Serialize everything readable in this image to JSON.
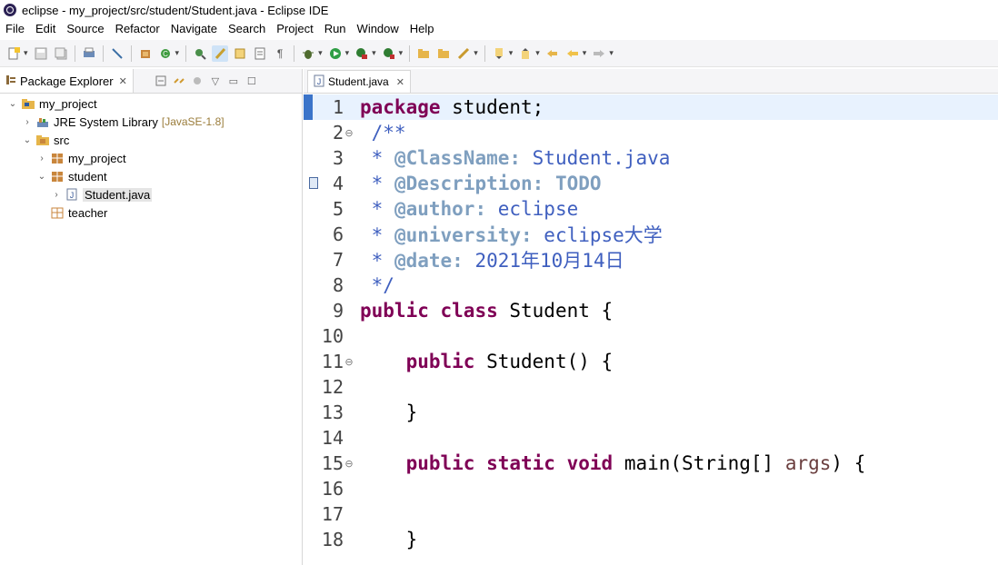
{
  "window": {
    "title": "eclipse - my_project/src/student/Student.java - Eclipse IDE",
    "app_icon": "eclipse-icon"
  },
  "menu": [
    "File",
    "Edit",
    "Source",
    "Refactor",
    "Navigate",
    "Search",
    "Project",
    "Run",
    "Window",
    "Help"
  ],
  "toolbar": {
    "icons": [
      "new-icon",
      "save-icon",
      "save-all-icon",
      "print-icon",
      "debug-skip-icon",
      "new-java-package-icon",
      "refresh-icon",
      "open-type-icon",
      "toggle-mark-icon",
      "open-task-icon",
      "open-task-list-icon",
      "pilcrow-icon",
      "debug-icon",
      "run-icon",
      "coverage-icon",
      "external-tools-icon",
      "open-folder-icon",
      "open-folder-2-icon",
      "search-icon",
      "next-annotation-icon",
      "prev-annotation-icon",
      "back-icon",
      "forward-icon"
    ]
  },
  "package_explorer": {
    "tab_label": "Package Explorer",
    "tree": [
      {
        "label": "my_project",
        "decor": "",
        "icon": "project-icon",
        "depth": 0,
        "chevron": "down",
        "selected": false
      },
      {
        "label": "JRE System Library",
        "decor": "[JavaSE-1.8]",
        "icon": "library-icon",
        "depth": 1,
        "chevron": "right",
        "selected": false
      },
      {
        "label": "src",
        "decor": "",
        "icon": "source-folder-icon",
        "depth": 1,
        "chevron": "down",
        "selected": false
      },
      {
        "label": "my_project",
        "decor": "",
        "icon": "package-icon",
        "depth": 2,
        "chevron": "right",
        "selected": false
      },
      {
        "label": "student",
        "decor": "",
        "icon": "package-icon",
        "depth": 2,
        "chevron": "down",
        "selected": false
      },
      {
        "label": "Student.java",
        "decor": "",
        "icon": "java-file-icon",
        "depth": 3,
        "chevron": "right",
        "selected": true
      },
      {
        "label": "teacher",
        "decor": "",
        "icon": "package-icon",
        "depth": 2,
        "chevron": "",
        "selected": false
      }
    ]
  },
  "editor": {
    "tab_label": "Student.java",
    "lines": [
      {
        "n": "1"
      },
      {
        "n": "2"
      },
      {
        "n": "3"
      },
      {
        "n": "4"
      },
      {
        "n": "5"
      },
      {
        "n": "6"
      },
      {
        "n": "7"
      },
      {
        "n": "8"
      },
      {
        "n": "9"
      },
      {
        "n": "10"
      },
      {
        "n": "11"
      },
      {
        "n": "12"
      },
      {
        "n": "13"
      },
      {
        "n": "14"
      },
      {
        "n": "15"
      },
      {
        "n": "16"
      },
      {
        "n": "17"
      },
      {
        "n": "18"
      }
    ],
    "code": {
      "l1_kw": "package",
      "l1_rest": " student;",
      "l2": " /**",
      "l3_star": " * ",
      "l3_tag": "@ClassName:",
      "l3_rest": " Student.java",
      "l4_star": " * ",
      "l4_tag": "@Description:",
      "l4_rest": " TODO",
      "l5_star": " * ",
      "l5_tag": "@author:",
      "l5_rest": " eclipse",
      "l6_star": " * ",
      "l6_tag": "@university:",
      "l6_rest": " eclipse大学",
      "l7_star": " * ",
      "l7_tag": "@date:",
      "l7_rest": " 2021年10月14日",
      "l8": " */",
      "l9_kw1": "public",
      "l9_kw2": "class",
      "l9_rest": " Student {",
      "l11_kw": "public",
      "l11_rest": " Student() {",
      "l13": "    }",
      "l15_kw1": "public",
      "l15_kw2": "static",
      "l15_kw3": "void",
      "l15_mid": " main(String[] ",
      "l15_arg": "args",
      "l15_end": ") {",
      "l18": "    }"
    }
  }
}
